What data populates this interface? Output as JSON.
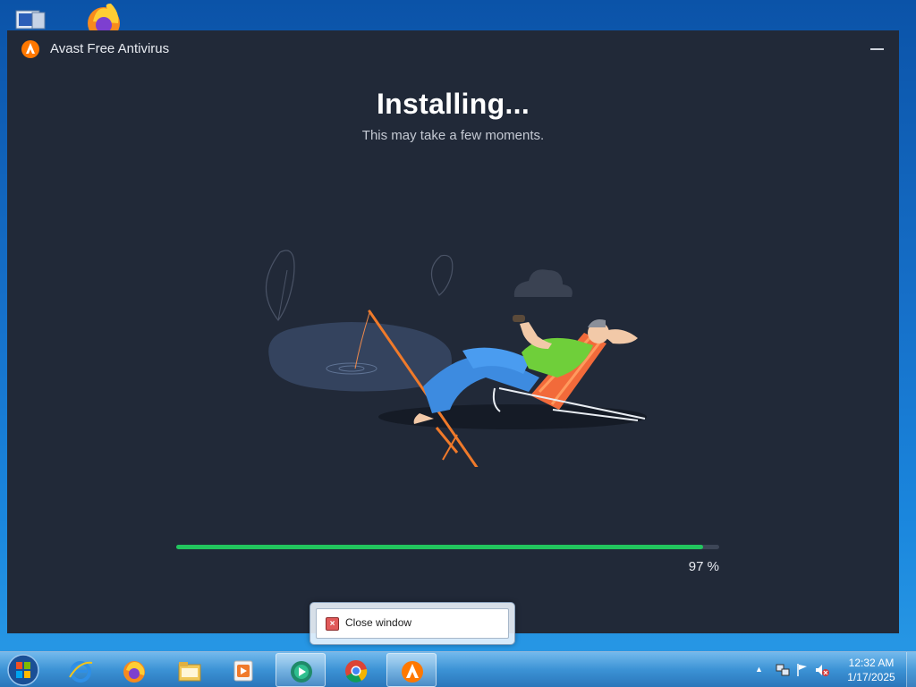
{
  "desktop": {
    "icons": [
      "computer-icon",
      "firefox-icon"
    ]
  },
  "window": {
    "title": "Avast Free Antivirus",
    "heading": "Installing...",
    "subheading": "This may take a few moments.",
    "progress": {
      "value": 97,
      "label": "97 %"
    },
    "illustration": "person-fishing-on-beach-chair",
    "accent_color": "#22c55e",
    "background_color": "#212938"
  },
  "thumbnail_popup": {
    "label": "Close window"
  },
  "taskbar": {
    "start": "windows-start-orb",
    "pinned": [
      {
        "name": "internet-explorer",
        "active": false
      },
      {
        "name": "firefox",
        "active": false
      },
      {
        "name": "file-explorer",
        "active": false
      },
      {
        "name": "media-player",
        "active": false
      },
      {
        "name": "media-center",
        "active": true
      },
      {
        "name": "chrome",
        "active": false
      },
      {
        "name": "avast",
        "active": true
      }
    ],
    "tray": {
      "icons": [
        "show-hidden-icons",
        "network-icon",
        "action-center-flag-icon",
        "volume-muted-icon"
      ],
      "time": "12:32 AM",
      "date": "1/17/2025"
    }
  }
}
